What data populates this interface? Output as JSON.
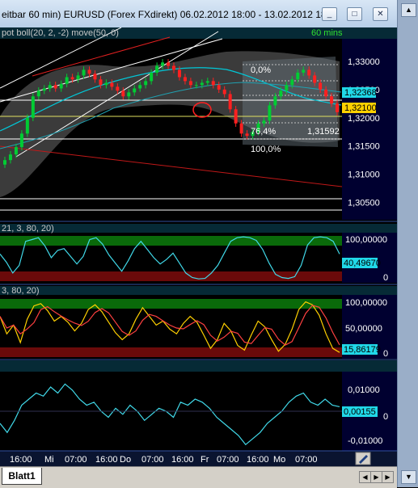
{
  "window": {
    "title": "eitbar 60 min)  EURUSD (Forex FXdirekt) 06.02.2012 18:00 - 13.02.2012 18...",
    "minimize": "_",
    "maximize": "□",
    "close": "✕"
  },
  "main_chart": {
    "indicator_label": "pot boll(20, 2, -2) move(50, 0)",
    "timeframe": "60 mins",
    "price_ticks": [
      "1,33000",
      "1,32500",
      "1,32000",
      "1,31500",
      "1,31000",
      "1,30500"
    ],
    "price_markers": [
      "1,32368",
      "1,32100"
    ],
    "fib_labels": [
      "0,0%",
      "76,4%",
      "1,31592",
      "100,0%"
    ]
  },
  "indicator1": {
    "label": "21, 3, 80, 20)",
    "ticks": [
      "100,00000",
      "0"
    ],
    "value": "40,49670"
  },
  "indicator2": {
    "label": "3, 80, 20)",
    "ticks": [
      "100,00000",
      "50,00000",
      "0"
    ],
    "value": "15,86179"
  },
  "indicator3": {
    "ticks": [
      "0,01000",
      "0",
      "-0,01000"
    ],
    "value": "0,00155"
  },
  "time_axis": [
    "16:00",
    "Mi",
    "07:00",
    "16:00",
    "Do",
    "07:00",
    "16:00",
    "Fr",
    "07:00",
    "16:00",
    "Mo",
    "07:00"
  ],
  "bottom": {
    "sheet_tab": "Blatt1"
  },
  "chart_data": {
    "type": "line",
    "title": "EURUSD (Forex FXdirekt) 06.02.2012 18:00 - 13.02.2012 18...",
    "ylim": [
      1.3025,
      1.334
    ],
    "series_colors": {
      "up": "#00cc33",
      "down": "#ff2020",
      "ma": "#00c8d8",
      "osc": "#40d8e8",
      "stoch_k": "#ffd000",
      "stoch_d": "#ff4040"
    },
    "close": [
      1.3125,
      1.3135,
      1.3148,
      1.3172,
      1.32,
      1.3238,
      1.3248,
      1.3252,
      1.3258,
      1.3252,
      1.326,
      1.3272,
      1.3268,
      1.3275,
      1.3285,
      1.3278,
      1.3268,
      1.3258,
      1.3262,
      1.3255,
      1.3248,
      1.3238,
      1.3245,
      1.3252,
      1.3258,
      1.3265,
      1.328,
      1.3292,
      1.3298,
      1.3292,
      1.3285,
      1.3272,
      1.3265,
      1.3258,
      1.3258,
      1.3262,
      1.3265,
      1.3258,
      1.325,
      1.3242,
      1.3215,
      1.319,
      1.3172,
      1.3168,
      1.3175,
      1.319,
      1.3195,
      1.3222,
      1.3238,
      1.3248,
      1.3258,
      1.3268,
      1.328,
      1.3285,
      1.3275,
      1.3262,
      1.325,
      1.3238,
      1.3225,
      1.321
    ],
    "stoch1": [
      60,
      42,
      18,
      35,
      88,
      92,
      96,
      78,
      52,
      68,
      72,
      55,
      38,
      55,
      92,
      96,
      82,
      58,
      40,
      22,
      45,
      72,
      88,
      70,
      52,
      38,
      48,
      62,
      40,
      18,
      8,
      5,
      6,
      18,
      35,
      62,
      88,
      96,
      98,
      96,
      90,
      70,
      40,
      15,
      8,
      6,
      10,
      35,
      80,
      96,
      98,
      96,
      88,
      60
    ],
    "stoch2": [
      70,
      40,
      55,
      25,
      65,
      88,
      92,
      80,
      62,
      70,
      60,
      45,
      58,
      82,
      90,
      78,
      60,
      42,
      30,
      40,
      65,
      85,
      70,
      55,
      62,
      48,
      40,
      58,
      70,
      60,
      38,
      15,
      30,
      58,
      45,
      20,
      12,
      38,
      62,
      52,
      30,
      10,
      22,
      48,
      82,
      95,
      90,
      72,
      40,
      15,
      8
    ],
    "osc": [
      -0.004,
      -0.007,
      -0.003,
      0.002,
      0.004,
      0.006,
      0.005,
      0.008,
      0.006,
      0.009,
      0.007,
      0.004,
      0.002,
      0.003,
      0.0,
      -0.002,
      0.001,
      -0.001,
      0.002,
      0.0,
      -0.003,
      -0.001,
      0.001,
      0.0,
      -0.002,
      0.003,
      0.002,
      0.004,
      0.003,
      0.001,
      -0.002,
      -0.004,
      -0.006,
      -0.008,
      -0.011,
      -0.009,
      -0.007,
      -0.004,
      -0.002,
      0.0,
      0.003,
      0.005,
      0.006,
      0.003,
      0.002,
      0.004,
      0.002,
      0.0015
    ]
  }
}
